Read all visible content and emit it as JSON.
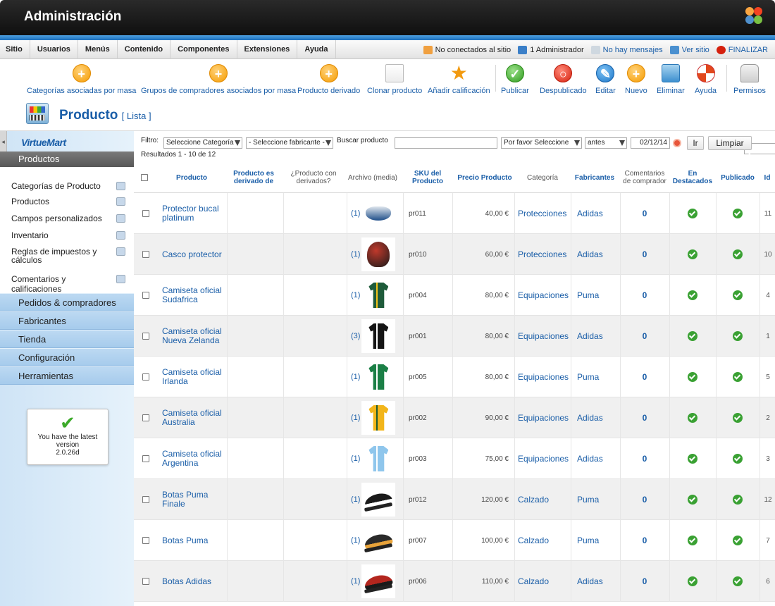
{
  "header": {
    "title": "Administración",
    "brand": "Joomla!"
  },
  "menu": [
    "Sitio",
    "Usuarios",
    "Menús",
    "Contenido",
    "Componentes",
    "Extensiones",
    "Ayuda"
  ],
  "status": {
    "offline": "No conectados al sitio",
    "admins": "1 Administrador",
    "messages": "No hay mensajes",
    "view_site": "Ver sitio",
    "logout": "FINALIZAR"
  },
  "toolbar": {
    "cat_assoc": "Categorías asociadas por masa",
    "group_assoc": "Grupos de compradores asociados por masa",
    "derived": "Producto derivado",
    "clone": "Clonar producto",
    "rate": "Añadir calificación",
    "publish": "Publicar",
    "unpublish": "Despublicado",
    "edit": "Editar",
    "new": "Nuevo",
    "delete": "Eliminar",
    "help": "Ayuda",
    "permissions": "Permisos"
  },
  "page": {
    "title": "Producto",
    "subtitle": "[ Lista ]"
  },
  "sidebar": {
    "logo": "VirtueMart",
    "active_section": "Productos",
    "items": [
      "Categorías de Producto",
      "Productos",
      "Campos personalizados",
      "Inventario",
      "Reglas de impuestos y cálculos",
      "Comentarios y calificaciones"
    ],
    "sections": [
      "Pedidos & compradores",
      "Fabricantes",
      "Tienda",
      "Configuración",
      "Herramientas"
    ],
    "version_line1": "You have the latest",
    "version_line2": "version",
    "version_line3": "2.0.26d"
  },
  "filter": {
    "label": "Filtro:",
    "category": "Seleccione Categoría",
    "manufacturer": "- Seleccione fabricante -",
    "search_label": "Buscar producto",
    "search_value": "",
    "date_type": "Por favor Seleccione",
    "period": "antes",
    "date": "02/12/14",
    "go": "Ir",
    "reset": "Limpiar",
    "results": "Resultados 1 - 10 de 12"
  },
  "columns": {
    "producto": "Producto",
    "derivado": "Producto es derivado de",
    "tiene_derivados": "¿Producto con derivados?",
    "archivo": "Archivo (media)",
    "sku": "SKU del Producto",
    "precio": "Precio Producto",
    "categoria": "Categoría",
    "fabricantes": "Fabricantes",
    "comentarios": "Comentarios de comprador",
    "destacados": "En Destacados",
    "publicado": "Publicado",
    "id": "Id"
  },
  "rows": [
    {
      "name": "Protector bucal platinum",
      "media": "(1)",
      "sku": "pr011",
      "price": "40,00 €",
      "category": "Protecciones",
      "manufacturer": "Adidas",
      "reviews": "0",
      "id": "11",
      "thumb": "guard",
      "c1": "#1f4e8a",
      "c2": "#dfe6ee"
    },
    {
      "name": "Casco protector",
      "media": "(1)",
      "sku": "pr010",
      "price": "60,00 €",
      "category": "Protecciones",
      "manufacturer": "Adidas",
      "reviews": "0",
      "id": "10",
      "thumb": "helmet",
      "c1": "#c0392b",
      "c2": "#1a1a1a"
    },
    {
      "name": "Camiseta oficial Sudafrica",
      "media": "(1)",
      "sku": "pr004",
      "price": "80,00 €",
      "category": "Equipaciones",
      "manufacturer": "Puma",
      "reviews": "0",
      "id": "4",
      "thumb": "shirt",
      "c1": "#1e5b3a",
      "c2": "#f3c21a"
    },
    {
      "name": "Camiseta oficial Nueva Zelanda",
      "media": "(3)",
      "sku": "pr001",
      "price": "80,00 €",
      "category": "Equipaciones",
      "manufacturer": "Adidas",
      "reviews": "0",
      "id": "1",
      "thumb": "shirt",
      "c1": "#151515",
      "c2": "#ffffff"
    },
    {
      "name": "Camiseta oficial Irlanda",
      "media": "(1)",
      "sku": "pr005",
      "price": "80,00 €",
      "category": "Equipaciones",
      "manufacturer": "Puma",
      "reviews": "0",
      "id": "5",
      "thumb": "shirt",
      "c1": "#1b7f46",
      "c2": "#ffffff"
    },
    {
      "name": "Camiseta oficial Australia",
      "media": "(1)",
      "sku": "pr002",
      "price": "90,00 €",
      "category": "Equipaciones",
      "manufacturer": "Adidas",
      "reviews": "0",
      "id": "2",
      "thumb": "shirt",
      "c1": "#f2b51a",
      "c2": "#1c5a30"
    },
    {
      "name": "Camiseta oficial Argentina",
      "media": "(1)",
      "sku": "pr003",
      "price": "75,00 €",
      "category": "Equipaciones",
      "manufacturer": "Adidas",
      "reviews": "0",
      "id": "3",
      "thumb": "shirt",
      "c1": "#8fc6ec",
      "c2": "#ffffff"
    },
    {
      "name": "Botas Puma Finale",
      "media": "(1)",
      "sku": "pr012",
      "price": "120,00 €",
      "category": "Calzado",
      "manufacturer": "Puma",
      "reviews": "0",
      "id": "12",
      "thumb": "shoe",
      "c1": "#1a1a1a",
      "c2": "#ffffff"
    },
    {
      "name": "Botas Puma",
      "media": "(1)",
      "sku": "pr007",
      "price": "100,00 €",
      "category": "Calzado",
      "manufacturer": "Puma",
      "reviews": "0",
      "id": "7",
      "thumb": "shoe",
      "c1": "#2a2a2a",
      "c2": "#e8a33a"
    },
    {
      "name": "Botas Adidas",
      "media": "(1)",
      "sku": "pr006",
      "price": "110,00 €",
      "category": "Calzado",
      "manufacturer": "Adidas",
      "reviews": "0",
      "id": "6",
      "thumb": "shoe",
      "c1": "#b3261e",
      "c2": "#1a1a1a"
    }
  ],
  "colors": {
    "accent": "#1a5ea8",
    "ok": "#3aa133",
    "header": "#1a1a1a",
    "sidebar": "#a6cbec"
  }
}
